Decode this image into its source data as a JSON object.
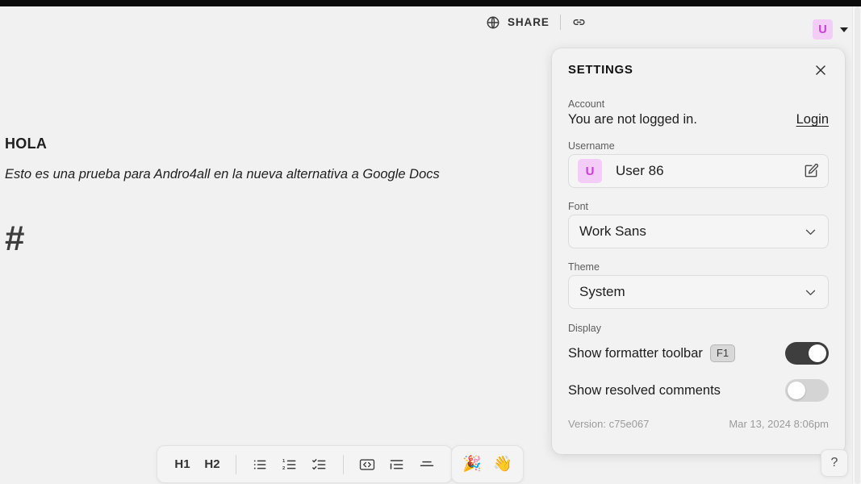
{
  "topbar": {
    "globe_icon": "globe-icon",
    "share_label": "SHARE",
    "link_icon": "link-icon",
    "avatar_initial": "U",
    "avatar_color": "#f3cdf7",
    "avatar_text_color": "#cd3ae0",
    "caret_icon": "chevron-down-icon"
  },
  "document": {
    "heading": "HOLA",
    "paragraph": "Esto es una prueba para Andro4all en la nueva alternativa a Google Docs",
    "hash_block": "#"
  },
  "settings": {
    "title": "SETTINGS",
    "close_icon": "close-icon",
    "account": {
      "label": "Account",
      "status": "You are not logged in.",
      "login_label": "Login"
    },
    "username": {
      "label": "Username",
      "avatar_initial": "U",
      "value": "User 86",
      "edit_icon": "edit-icon"
    },
    "font": {
      "label": "Font",
      "value": "Work Sans",
      "chevron_icon": "chevron-down-icon"
    },
    "theme": {
      "label": "Theme",
      "value": "System",
      "chevron_icon": "chevron-down-icon"
    },
    "display": {
      "label": "Display",
      "formatter_toolbar": {
        "label": "Show formatter toolbar",
        "shortcut": "F1",
        "state": "on"
      },
      "resolved_comments": {
        "label": "Show resolved comments",
        "state": "off"
      }
    },
    "footer": {
      "version": "Version: c75e067",
      "timestamp": "Mar 13, 2024 8:06pm"
    }
  },
  "formatter_toolbar": {
    "buttons": [
      {
        "name": "heading-1-button",
        "label": "H1",
        "type": "text"
      },
      {
        "name": "heading-2-button",
        "label": "H2",
        "type": "text"
      },
      {
        "name": "bullet-list-button",
        "label": "bullet-list-icon",
        "type": "icon"
      },
      {
        "name": "numbered-list-button",
        "label": "numbered-list-icon",
        "type": "icon"
      },
      {
        "name": "checklist-button",
        "label": "checklist-icon",
        "type": "icon"
      },
      {
        "name": "code-block-button",
        "label": "code-block-icon",
        "type": "icon"
      },
      {
        "name": "indent-button",
        "label": "indent-icon",
        "type": "icon"
      },
      {
        "name": "horizontal-rule-button",
        "label": "horizontal-rule-icon",
        "type": "icon"
      }
    ]
  },
  "emoji_toolbar": {
    "buttons": [
      {
        "name": "party-popper-button",
        "glyph": "🎉"
      },
      {
        "name": "wave-hand-button",
        "glyph": "👋"
      }
    ]
  },
  "help": {
    "label": "?"
  }
}
